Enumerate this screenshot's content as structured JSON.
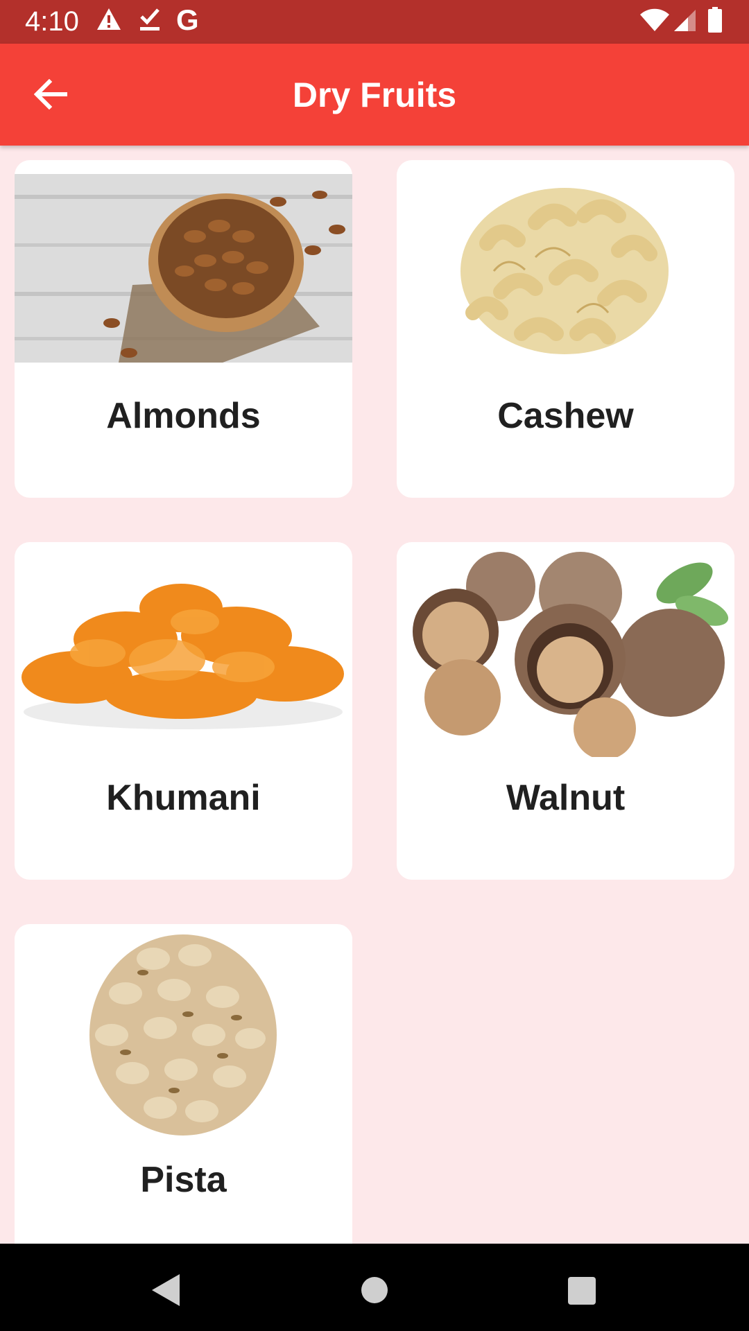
{
  "status_bar": {
    "time": "4:10",
    "icons": [
      "warning-icon",
      "download-done-icon",
      "google-g-icon",
      "wifi-icon",
      "signal-icon",
      "battery-icon"
    ],
    "g_label": "G"
  },
  "app_bar": {
    "title": "Dry Fruits",
    "back_icon": "arrow-back-icon",
    "color": "#f44138",
    "status_color": "#b3302b"
  },
  "background_color": "#fde8ea",
  "items": [
    {
      "label": "Almonds",
      "image": "almonds-photo"
    },
    {
      "label": "Cashew",
      "image": "cashew-photo"
    },
    {
      "label": "Khumani",
      "image": "apricot-photo"
    },
    {
      "label": "Walnut",
      "image": "walnut-photo"
    },
    {
      "label": "Pista",
      "image": "pistachio-photo"
    }
  ],
  "nav_bar": {
    "icons": [
      "back-triangle-icon",
      "home-circle-icon",
      "recents-square-icon"
    ]
  }
}
